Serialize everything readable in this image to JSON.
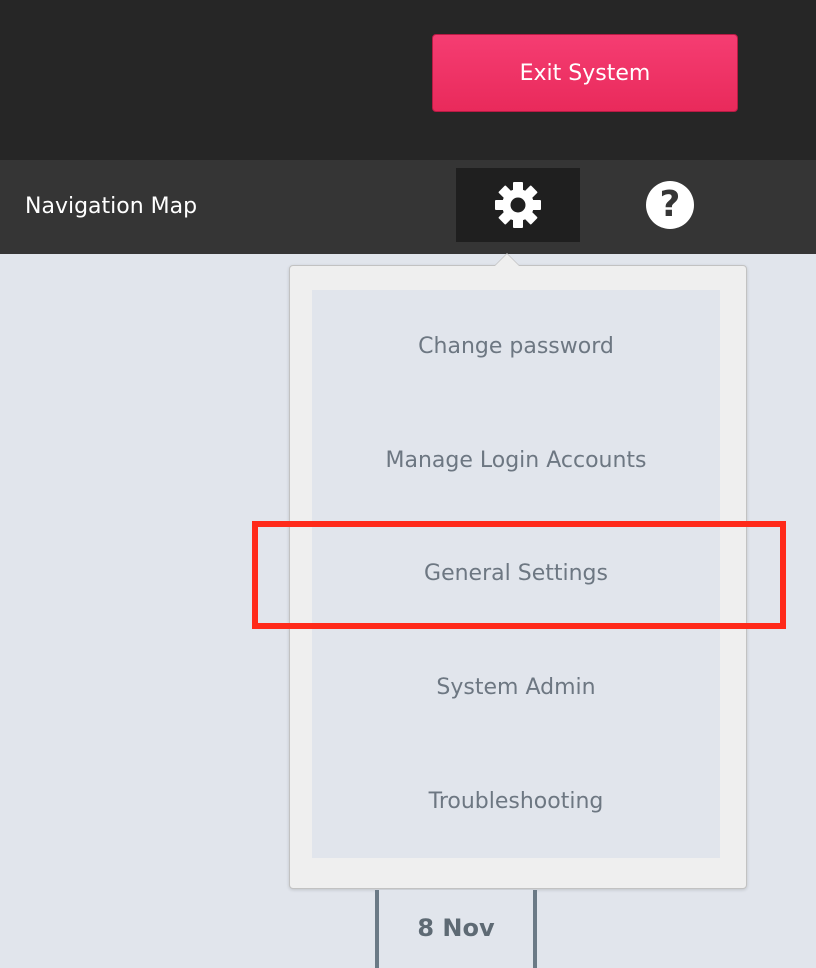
{
  "header": {
    "exit_label": "Exit System"
  },
  "nav": {
    "title": "Navigation Map",
    "settings_icon": "gear-icon",
    "help_icon": "help-icon",
    "help_glyph": "?"
  },
  "menu": {
    "items": [
      {
        "label": "Change password"
      },
      {
        "label": "Manage Login Accounts"
      },
      {
        "label": "General Settings"
      },
      {
        "label": "System Admin"
      },
      {
        "label": "Troubleshooting"
      }
    ],
    "highlighted_item": "General Settings"
  },
  "calendar": {
    "date_label": "8 Nov"
  },
  "colors": {
    "exit_button": "#f0336a",
    "header_bg": "#262626",
    "nav_bg": "#353535",
    "page_bg": "#e1e5ec",
    "highlight": "#ff2a1a"
  }
}
